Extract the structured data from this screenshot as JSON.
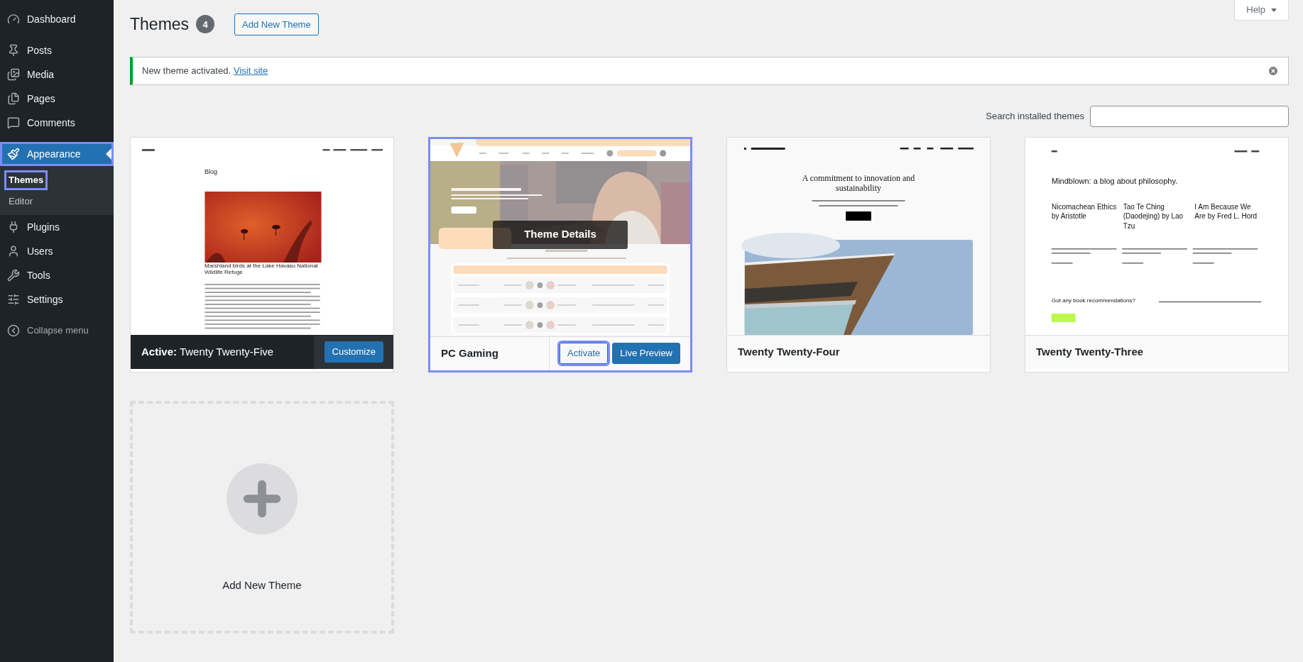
{
  "sidebar": {
    "groups": [
      [
        {
          "label": "Dashboard",
          "selected": false,
          "highlighted": false
        }
      ],
      [
        {
          "label": "Posts",
          "selected": false,
          "highlighted": false
        },
        {
          "label": "Media",
          "selected": false,
          "highlighted": false
        },
        {
          "label": "Pages",
          "selected": false,
          "highlighted": false
        },
        {
          "label": "Comments",
          "selected": false,
          "highlighted": false
        }
      ],
      [
        {
          "label": "Appearance",
          "selected": true,
          "highlighted": true,
          "children": [
            {
              "label": "Themes",
              "selected": true,
              "highlighted": true
            },
            {
              "label": "Editor",
              "selected": false,
              "highlighted": false
            }
          ]
        },
        {
          "label": "Plugins",
          "selected": false,
          "highlighted": false
        },
        {
          "label": "Users",
          "selected": false,
          "highlighted": false
        },
        {
          "label": "Tools",
          "selected": false,
          "highlighted": false
        },
        {
          "label": "Settings",
          "selected": false,
          "highlighted": false
        }
      ]
    ],
    "collapse": "Collapse menu"
  },
  "header": {
    "title": "Themes",
    "count": "4",
    "add_button": "Add New Theme",
    "help": "Help"
  },
  "notice": {
    "text": "New theme activated.",
    "link": "Visit site"
  },
  "search": {
    "label": "Search installed themes"
  },
  "themes": [
    {
      "name": "Twenty Twenty-Five",
      "active": true,
      "active_label": "Active:",
      "hovered": false,
      "highlighted": false,
      "actions": [
        {
          "label": "Customize",
          "kind": "primary",
          "highlighted": false
        }
      ],
      "thumbnail": {
        "kind": "blog",
        "heading": "Blog",
        "post_title": "Marshland birds at the Lake Havasu National Wildlife Refuge"
      }
    },
    {
      "name": "PC Gaming",
      "active": false,
      "hovered": true,
      "overlay": "Theme Details",
      "highlighted": true,
      "actions": [
        {
          "label": "Activate",
          "kind": "secondary",
          "highlighted": true
        },
        {
          "label": "Live Preview",
          "kind": "primary",
          "highlighted": false
        }
      ],
      "thumbnail": {
        "kind": "gaming"
      }
    },
    {
      "name": "Twenty Twenty-Four",
      "active": false,
      "hovered": false,
      "highlighted": false,
      "thumbnail": {
        "kind": "business",
        "heading": "A commitment to innovation and sustainability"
      }
    },
    {
      "name": "Twenty Twenty-Three",
      "active": false,
      "hovered": false,
      "highlighted": false,
      "thumbnail": {
        "kind": "philosophy",
        "heading": "Mindblown: a blog about philosophy.",
        "posts": [
          "Nicomachean Ethics by Aristotle",
          "Tao Te Ching (Daodejing) by Lao Tzu",
          "I Am Because We Are by Fred L. Hord"
        ],
        "cta": "Got any book recommendations?"
      }
    }
  ],
  "add_card": {
    "label": "Add New Theme"
  }
}
